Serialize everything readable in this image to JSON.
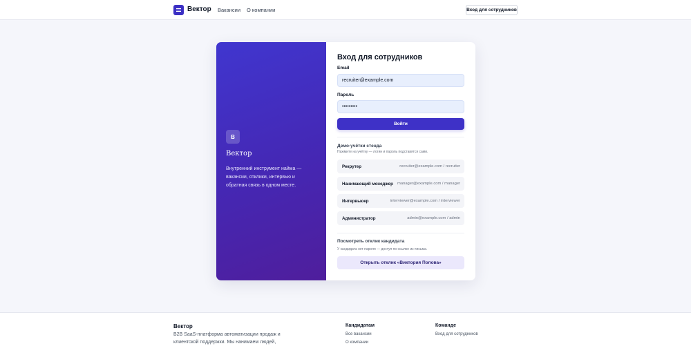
{
  "header": {
    "brand": "Вектор",
    "nav": [
      "Вакансии",
      "О компании"
    ],
    "login_button": "Вход для сотрудников"
  },
  "promo": {
    "badge": "В",
    "title": "Вектор",
    "description": "Внутренний инструмент найма — вакансии, отклики, интервью и обратная связь в одном месте."
  },
  "login_form": {
    "title": "Вход для сотрудников",
    "email_label": "Email",
    "email_value": "recruiter@example.com",
    "password_label": "Пароль",
    "password_value": "•••••••••",
    "submit_label": "Войти"
  },
  "demo": {
    "title": "Демо-учётки стенда",
    "subtitle": "Нажмите на учётку — логин и пароль подставятся сами.",
    "accounts": [
      {
        "role": "Рекрутер",
        "credentials": "recruiter@example.com / recruiter"
      },
      {
        "role": "Нанимающий менеджер",
        "credentials": "manager@example.com / manager"
      },
      {
        "role": "Интервьюер",
        "credentials": "interviewer@example.com / interviewer"
      },
      {
        "role": "Администратор",
        "credentials": "admin@example.com / admin"
      }
    ]
  },
  "candidate": {
    "title": "Посмотреть отклик кандидата",
    "subtitle": "У кандидата нет пароля — доступ по ссылке из письма.",
    "button": "Открыть отклик «Виктория Попова»"
  },
  "footer": {
    "brand": "Вектор",
    "description": "B2B SaaS-платформа автоматизации продаж и клиентской поддержки. Мы нанимаем людей,",
    "candidates_heading": "Кандидатам",
    "candidates_links": [
      "Все вакансии",
      "О компании"
    ],
    "team_heading": "Команде",
    "team_links": [
      "Вход для сотрудников"
    ]
  },
  "colors": {
    "accent": "#3e31c7",
    "promo_gradient_start": "#4036cf",
    "promo_gradient_end": "#4f1e9c",
    "input_bg": "#e8effd",
    "candidate_button_bg": "#ebe8fc"
  },
  "icons": {
    "logo": "menu-lines-icon"
  }
}
